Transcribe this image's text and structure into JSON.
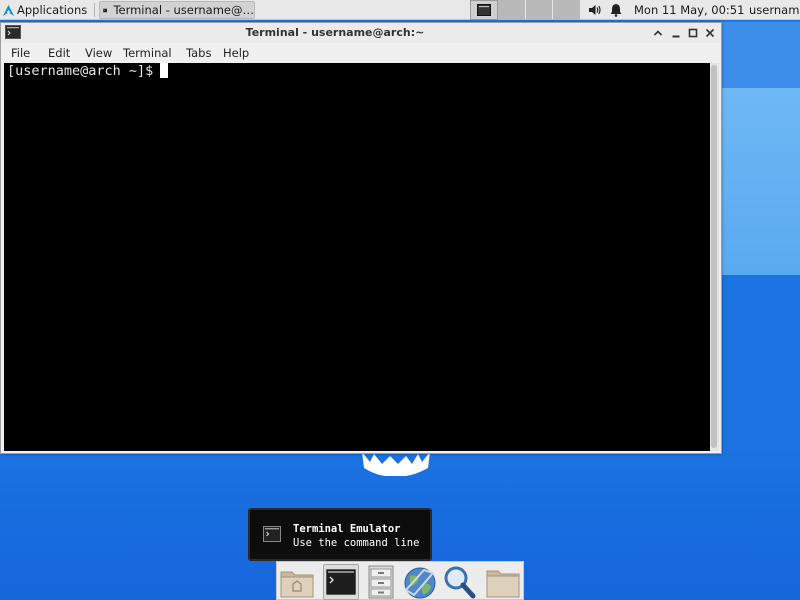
{
  "top_panel": {
    "applications_label": "Applications",
    "task_label": "Terminal - username@…",
    "clock": "Mon 11 May, 00:51",
    "user": "username"
  },
  "window": {
    "title": "Terminal - username@arch:~",
    "menu": [
      "File",
      "Edit",
      "View",
      "Terminal",
      "Tabs",
      "Help"
    ],
    "prompt": "[username@arch ~]$"
  },
  "tooltip": {
    "title": "Terminal Emulator",
    "subtitle": "Use the command line"
  },
  "dock": {
    "items": [
      "home-folder-icon",
      "terminal-icon",
      "file-cabinet-icon",
      "web-browser-icon",
      "search-icon",
      "folder-icon"
    ]
  },
  "colors": {
    "panel_bg": "#e8e8e8",
    "terminal_bg": "#000000",
    "desktop_blue": "#1a6fdc"
  }
}
